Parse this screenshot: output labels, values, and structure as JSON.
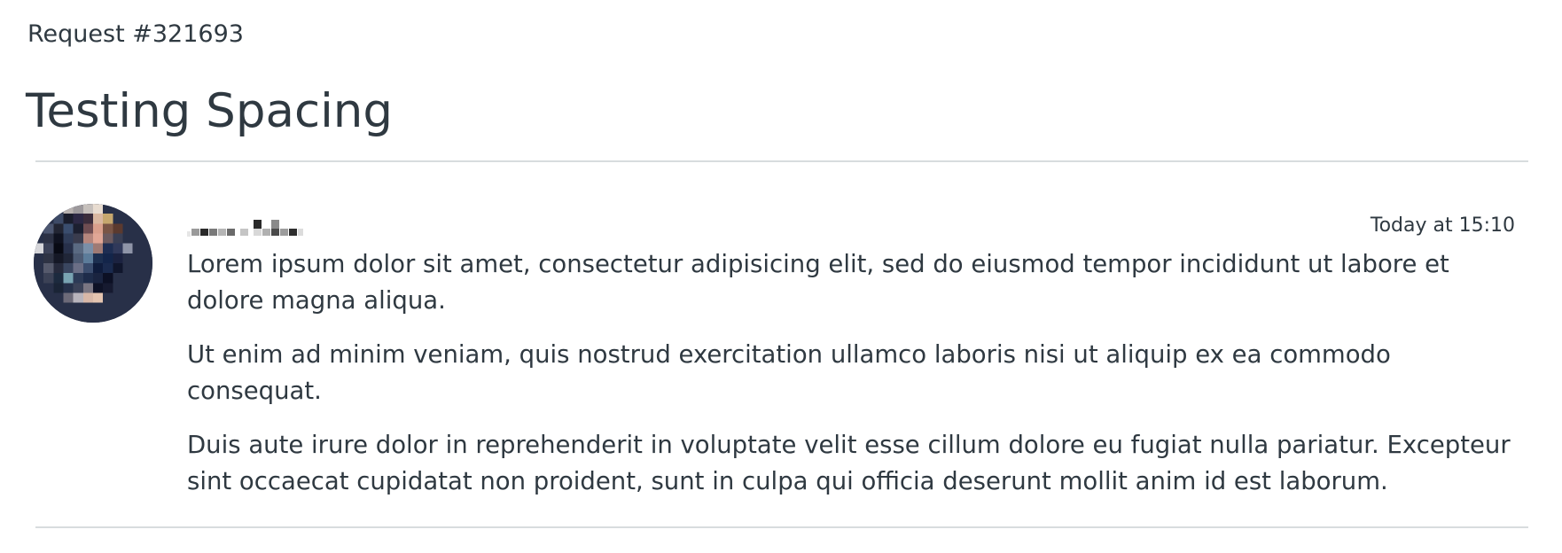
{
  "request": {
    "id_label": "Request #321693"
  },
  "page": {
    "title": "Testing Spacing"
  },
  "comment": {
    "author_avatar": "user-avatar (pixelated)",
    "author_name_redacted": "pixelated-name",
    "timestamp": "Today at 15:10",
    "paragraphs": [
      "Lorem ipsum dolor sit amet, consectetur adipisicing elit, sed do eiusmod tempor incididunt ut labore et dolore magna aliqua.",
      "Ut enim ad minim veniam, quis nostrud exercitation ullamco laboris nisi ut aliquip ex ea commodo consequat.",
      "Duis aute irure dolor in reprehenderit in voluptate velit esse cillum dolore eu fugiat nulla pariatur. Excepteur sint occaecat cupidatat non proident, sunt in culpa qui officia deserunt mollit anim id est laborum."
    ]
  },
  "colors": {
    "text": "#2f3941",
    "divider": "#d8dcde",
    "background": "#ffffff"
  }
}
